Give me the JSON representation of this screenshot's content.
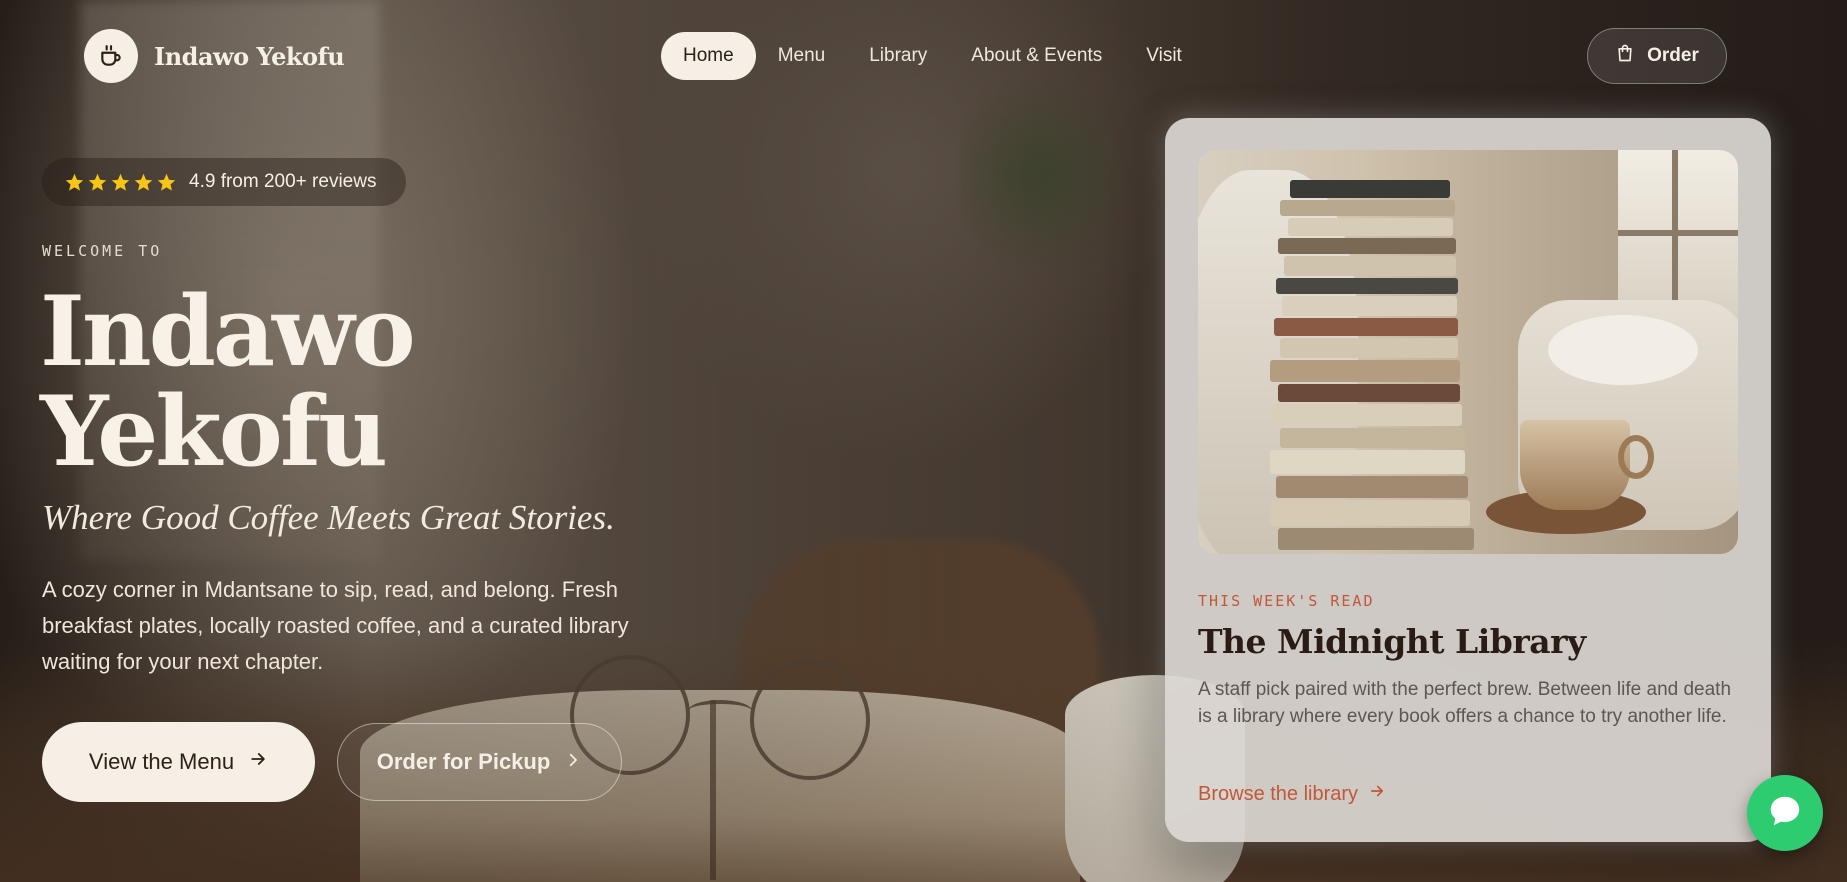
{
  "brand": {
    "name": "Indawo Yekofu",
    "logo_icon": "coffee-cup-icon"
  },
  "nav": {
    "items": [
      {
        "label": "Home",
        "active": true
      },
      {
        "label": "Menu",
        "active": false
      },
      {
        "label": "Library",
        "active": false
      },
      {
        "label": "About & Events",
        "active": false
      },
      {
        "label": "Visit",
        "active": false
      }
    ],
    "order_label": "Order",
    "order_icon": "shopping-bag-icon"
  },
  "hero": {
    "rating": {
      "stars": 5,
      "text": "4.9 from 200+ reviews",
      "star_color": "#f5c518"
    },
    "eyebrow": "WELCOME TO",
    "title_line1": "Indawo",
    "title_line2": "Yekofu",
    "tagline": "Where Good Coffee Meets Great Stories.",
    "description": "A cozy corner in Mdantsane to sip, read, and belong. Fresh breakfast plates, locally roasted coffee, and a curated library waiting for your next chapter.",
    "primary_cta": "View the Menu",
    "secondary_cta": "Order for Pickup"
  },
  "feature_card": {
    "eyebrow": "THIS WEEK'S READ",
    "title": "The Midnight Library",
    "description": "A staff pick paired with the perfect brew. Between life and death is a library where every book offers a chance to try another life.",
    "link_label": "Browse the library",
    "accent_color": "#c0583a"
  },
  "chat": {
    "icon": "chat-bubble-icon",
    "color": "#2ecc71"
  }
}
